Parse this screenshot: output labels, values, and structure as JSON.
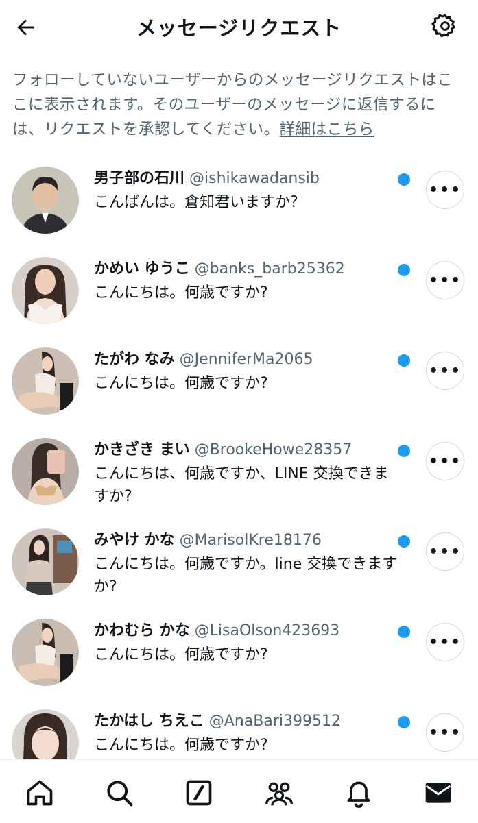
{
  "header": {
    "title": "メッセージリクエスト",
    "back_icon": "arrow-left-icon",
    "settings_icon": "gear-icon"
  },
  "notice": {
    "text": "フォローしていないユーザーからのメッセージリクエストはここに表示されます。そのユーザーのメッセージに返信するには、リクエストを承認してください。",
    "link": "詳細はこちら"
  },
  "requests": [
    {
      "name": "男子部の石川",
      "handle": "@ishikawadansib",
      "message": "こんばんは。倉知君いますか？",
      "unread": true
    },
    {
      "name": "かめい ゆうこ",
      "handle": "@banks_barb25362",
      "message": "こんにちは。何歳ですか?",
      "unread": true
    },
    {
      "name": "たがわ なみ",
      "handle": "@JenniferMa2065",
      "message": "こんにちは。何歳ですか?",
      "unread": true
    },
    {
      "name": "かきざき まい",
      "handle": "@BrookeHowe28357",
      "message": "こんにちは、何歳ですか、LINE 交換できますか?",
      "unread": true
    },
    {
      "name": "みやけ かな",
      "handle": "@MarisolKre18176",
      "message": "こんにちは。何歳ですか。line 交換できますか?",
      "unread": true
    },
    {
      "name": "かわむら かな",
      "handle": "@LisaOlson423693",
      "message": "こんにちは。何歳ですか?",
      "unread": true
    },
    {
      "name": "たかはし ちえこ",
      "handle": "@AnaBari399512",
      "message": "こんにちは。何歳ですか?",
      "unread": true
    }
  ],
  "more_label": "•••",
  "colors": {
    "accent": "#1d9bf0",
    "text_primary": "#0f1419",
    "text_secondary": "#536471"
  },
  "bottom_nav": [
    {
      "icon": "home-icon"
    },
    {
      "icon": "search-icon"
    },
    {
      "icon": "compose-icon"
    },
    {
      "icon": "communities-icon"
    },
    {
      "icon": "bell-icon"
    },
    {
      "icon": "mail-icon",
      "active": true
    }
  ]
}
